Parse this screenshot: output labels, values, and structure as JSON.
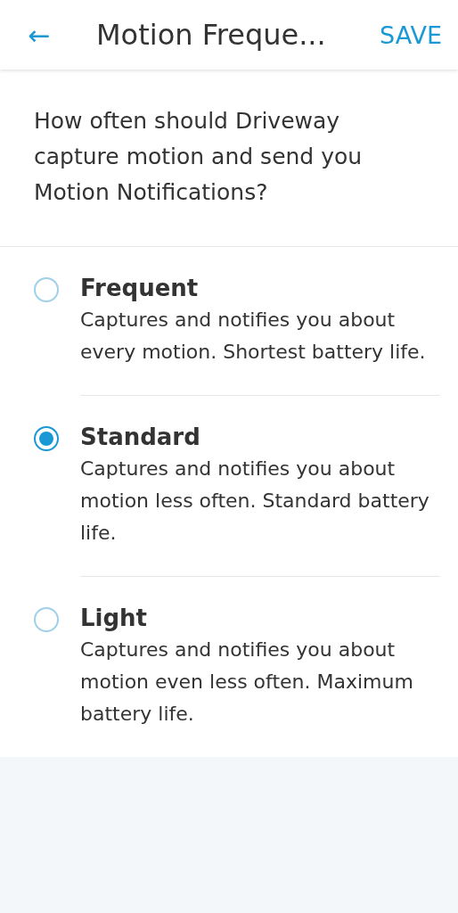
{
  "header": {
    "back_icon": "←",
    "title": "Motion Freque...",
    "save": "SAVE"
  },
  "question": "How often should Driveway capture motion and send you Motion Notifications?",
  "options": [
    {
      "title": "Frequent",
      "description": "Captures and notifies you about every motion. Shortest battery life.",
      "selected": false
    },
    {
      "title": "Standard",
      "description": "Captures and notifies you about motion less often. Standard battery life.",
      "selected": true
    },
    {
      "title": "Light",
      "description": "Captures and notifies you about motion even less often. Maximum battery life.",
      "selected": false
    }
  ]
}
